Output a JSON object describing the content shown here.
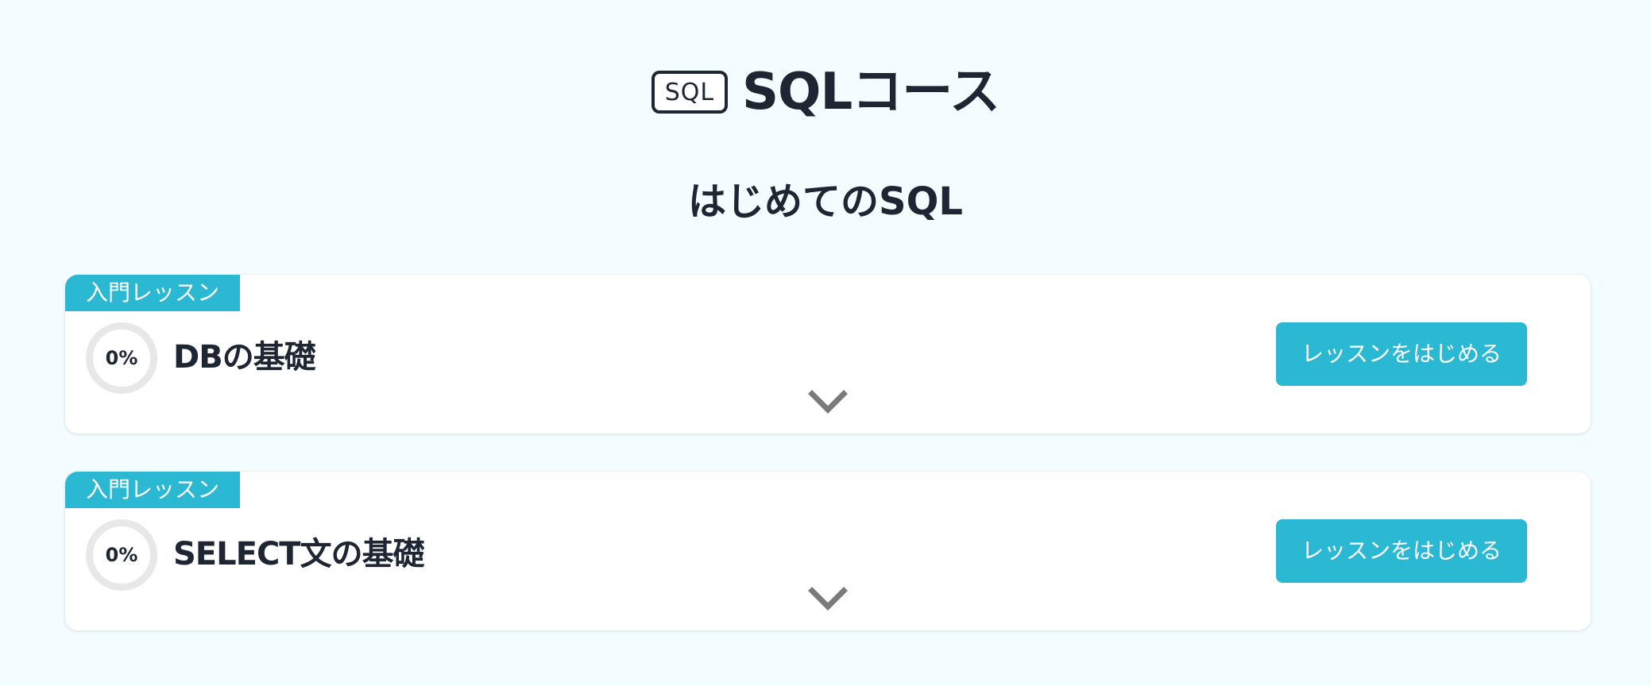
{
  "header": {
    "icon": "sql-icon",
    "icon_text": "SQL",
    "title": "SQLコース"
  },
  "section": {
    "title": "はじめてのSQL"
  },
  "lessons": [
    {
      "tag": "入門レッスン",
      "progress": "0%",
      "progress_fraction": 0,
      "title": "DBの基礎",
      "button_label": "レッスンをはじめる",
      "expand_icon": "chevron-down-icon"
    },
    {
      "tag": "入門レッスン",
      "progress": "0%",
      "progress_fraction": 0,
      "title": "SELECT文の基礎",
      "button_label": "レッスンをはじめる",
      "expand_icon": "chevron-down-icon"
    }
  ],
  "colors": {
    "accent": "#2bb8d3",
    "background": "#f3fcfe",
    "text": "#1e2533",
    "progress_track": "#e8e8e8",
    "chevron": "#7a7a7a"
  }
}
